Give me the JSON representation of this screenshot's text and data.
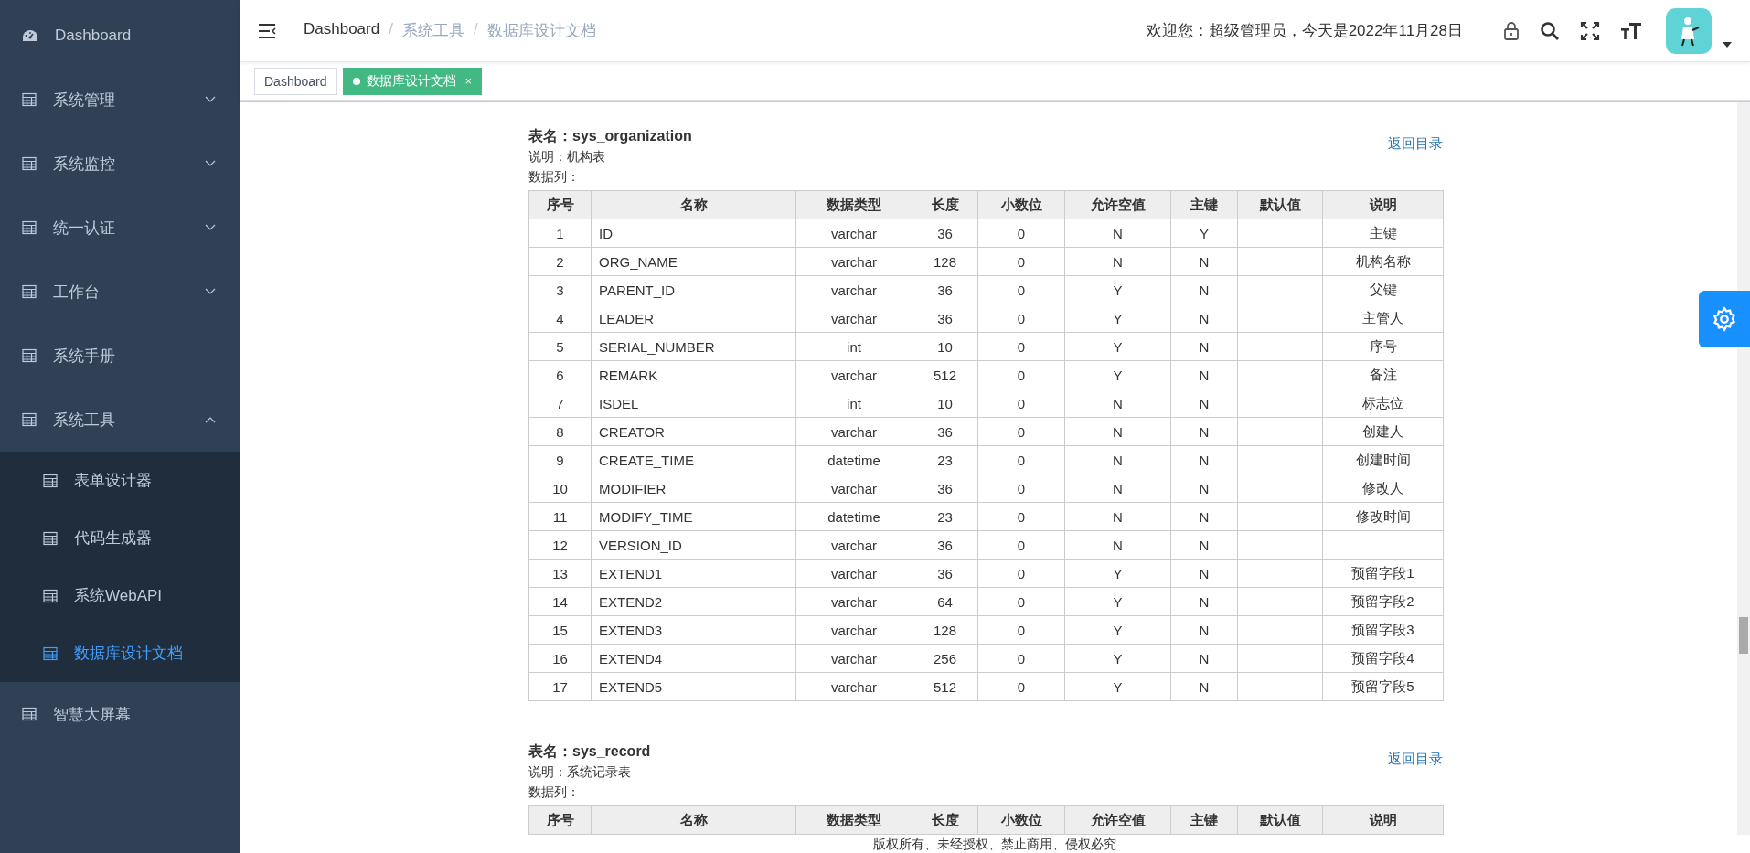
{
  "sidebar": {
    "items": [
      {
        "kind": "dashboard",
        "label": "Dashboard",
        "selected": false
      },
      {
        "kind": "group",
        "label": "系统管理",
        "expanded": false
      },
      {
        "kind": "group",
        "label": "系统监控",
        "expanded": false
      },
      {
        "kind": "group",
        "label": "统一认证",
        "expanded": false
      },
      {
        "kind": "group",
        "label": "工作台",
        "expanded": false
      },
      {
        "kind": "item",
        "label": "系统手册",
        "selected": false
      },
      {
        "kind": "group",
        "label": "系统工具",
        "expanded": true,
        "children": [
          {
            "label": "表单设计器",
            "selected": false
          },
          {
            "label": "代码生成器",
            "selected": false
          },
          {
            "label": "系统WebAPI",
            "selected": false
          },
          {
            "label": "数据库设计文档",
            "selected": true
          }
        ]
      },
      {
        "kind": "item",
        "label": "智慧大屏幕",
        "selected": false
      }
    ]
  },
  "breadcrumb": [
    "Dashboard",
    "系统工具",
    "数据库设计文档"
  ],
  "breadcrumb_separators": [
    "/",
    "/"
  ],
  "welcome": "欢迎您：超级管理员，今天是2022年11月28日",
  "tabs": [
    {
      "label": "Dashboard",
      "selected": false,
      "closable": false
    },
    {
      "label": "数据库设计文档",
      "selected": true,
      "closable": true,
      "close": "×"
    }
  ],
  "tables": [
    {
      "name_label": "表名：",
      "name": "sys_organization",
      "description": "说明：机构表",
      "columns_label": "数据列：",
      "back_link": "返回目录",
      "columns": [
        "序号",
        "名称",
        "数据类型",
        "长度",
        "小数位",
        "允许空值",
        "主键",
        "默认值",
        "说明"
      ],
      "rows": [
        [
          "1",
          "ID",
          "varchar",
          "36",
          "0",
          "N",
          "Y",
          "",
          "主键"
        ],
        [
          "2",
          "ORG_NAME",
          "varchar",
          "128",
          "0",
          "N",
          "N",
          "",
          "机构名称"
        ],
        [
          "3",
          "PARENT_ID",
          "varchar",
          "36",
          "0",
          "Y",
          "N",
          "",
          "父键"
        ],
        [
          "4",
          "LEADER",
          "varchar",
          "36",
          "0",
          "Y",
          "N",
          "",
          "主管人"
        ],
        [
          "5",
          "SERIAL_NUMBER",
          "int",
          "10",
          "0",
          "Y",
          "N",
          "",
          "序号"
        ],
        [
          "6",
          "REMARK",
          "varchar",
          "512",
          "0",
          "Y",
          "N",
          "",
          "备注"
        ],
        [
          "7",
          "ISDEL",
          "int",
          "10",
          "0",
          "N",
          "N",
          "",
          "标志位"
        ],
        [
          "8",
          "CREATOR",
          "varchar",
          "36",
          "0",
          "N",
          "N",
          "",
          "创建人"
        ],
        [
          "9",
          "CREATE_TIME",
          "datetime",
          "23",
          "0",
          "N",
          "N",
          "",
          "创建时间"
        ],
        [
          "10",
          "MODIFIER",
          "varchar",
          "36",
          "0",
          "N",
          "N",
          "",
          "修改人"
        ],
        [
          "11",
          "MODIFY_TIME",
          "datetime",
          "23",
          "0",
          "N",
          "N",
          "",
          "修改时间"
        ],
        [
          "12",
          "VERSION_ID",
          "varchar",
          "36",
          "0",
          "N",
          "N",
          "",
          ""
        ],
        [
          "13",
          "EXTEND1",
          "varchar",
          "36",
          "0",
          "Y",
          "N",
          "",
          "预留字段1"
        ],
        [
          "14",
          "EXTEND2",
          "varchar",
          "64",
          "0",
          "Y",
          "N",
          "",
          "预留字段2"
        ],
        [
          "15",
          "EXTEND3",
          "varchar",
          "128",
          "0",
          "Y",
          "N",
          "",
          "预留字段3"
        ],
        [
          "16",
          "EXTEND4",
          "varchar",
          "256",
          "0",
          "Y",
          "N",
          "",
          "预留字段4"
        ],
        [
          "17",
          "EXTEND5",
          "varchar",
          "512",
          "0",
          "Y",
          "N",
          "",
          "预留字段5"
        ]
      ]
    },
    {
      "name_label": "表名：",
      "name": "sys_record",
      "description": "说明：系统记录表",
      "columns_label": "数据列：",
      "back_link": "返回目录",
      "columns": [
        "序号",
        "名称",
        "数据类型",
        "长度",
        "小数位",
        "允许空值",
        "主键",
        "默认值",
        "说明"
      ]
    }
  ],
  "footer": "版权所有、未经授权、禁止商用、侵权必究"
}
